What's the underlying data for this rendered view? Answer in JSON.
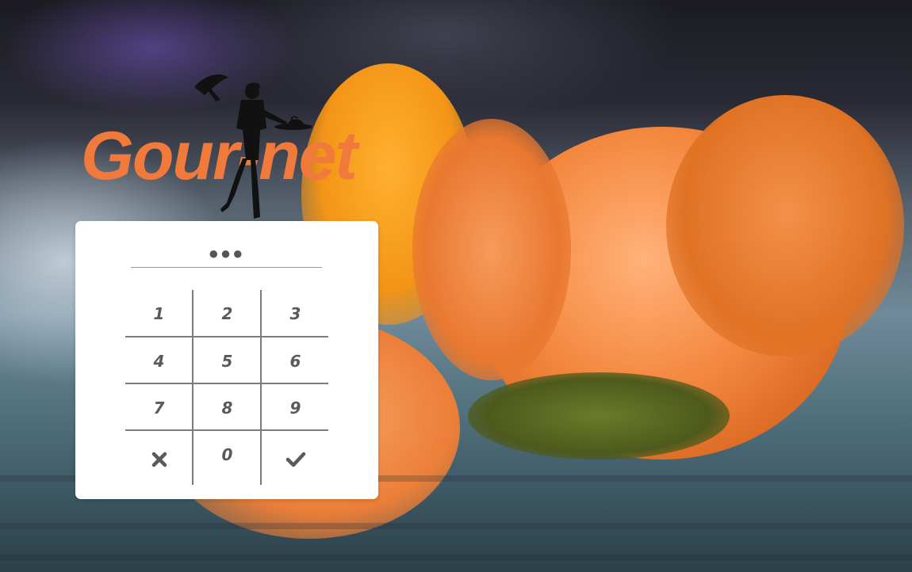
{
  "logo": {
    "text": "Gour-net",
    "letter": "G"
  },
  "pin": {
    "masked_value": "●●●"
  },
  "keypad": {
    "keys": [
      "1",
      "2",
      "3",
      "4",
      "5",
      "6",
      "7",
      "8",
      "9"
    ],
    "zero": "0",
    "clear_icon": "x-icon",
    "confirm_icon": "checkmark-icon"
  },
  "colors": {
    "brand_orange": "#ef7a3b",
    "key_text": "#5a5a5a",
    "card_bg": "#ffffff"
  }
}
